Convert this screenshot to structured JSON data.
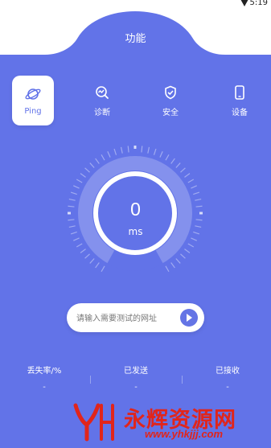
{
  "status": {
    "time": "5:19"
  },
  "header": {
    "title": "功能"
  },
  "colors": {
    "primary": "#6273e8",
    "white": "#ffffff",
    "watermark": "#e1251b"
  },
  "tabs": [
    {
      "label": "Ping",
      "icon": "planet-icon",
      "active": true
    },
    {
      "label": "诊断",
      "icon": "diagnose-icon",
      "active": false
    },
    {
      "label": "安全",
      "icon": "shield-check-icon",
      "active": false
    },
    {
      "label": "设备",
      "icon": "phone-icon",
      "active": false
    }
  ],
  "gauge": {
    "value": "0",
    "unit": "ms"
  },
  "url_input": {
    "placeholder": "请输入需要测试的网址",
    "value": ""
  },
  "stats": [
    {
      "label": "丢失率/%",
      "value": "-"
    },
    {
      "label": "已发送",
      "value": "-"
    },
    {
      "label": "已接收",
      "value": "-"
    }
  ],
  "watermark": {
    "title": "永辉资源网",
    "url": "www.yhkjjj.com"
  }
}
